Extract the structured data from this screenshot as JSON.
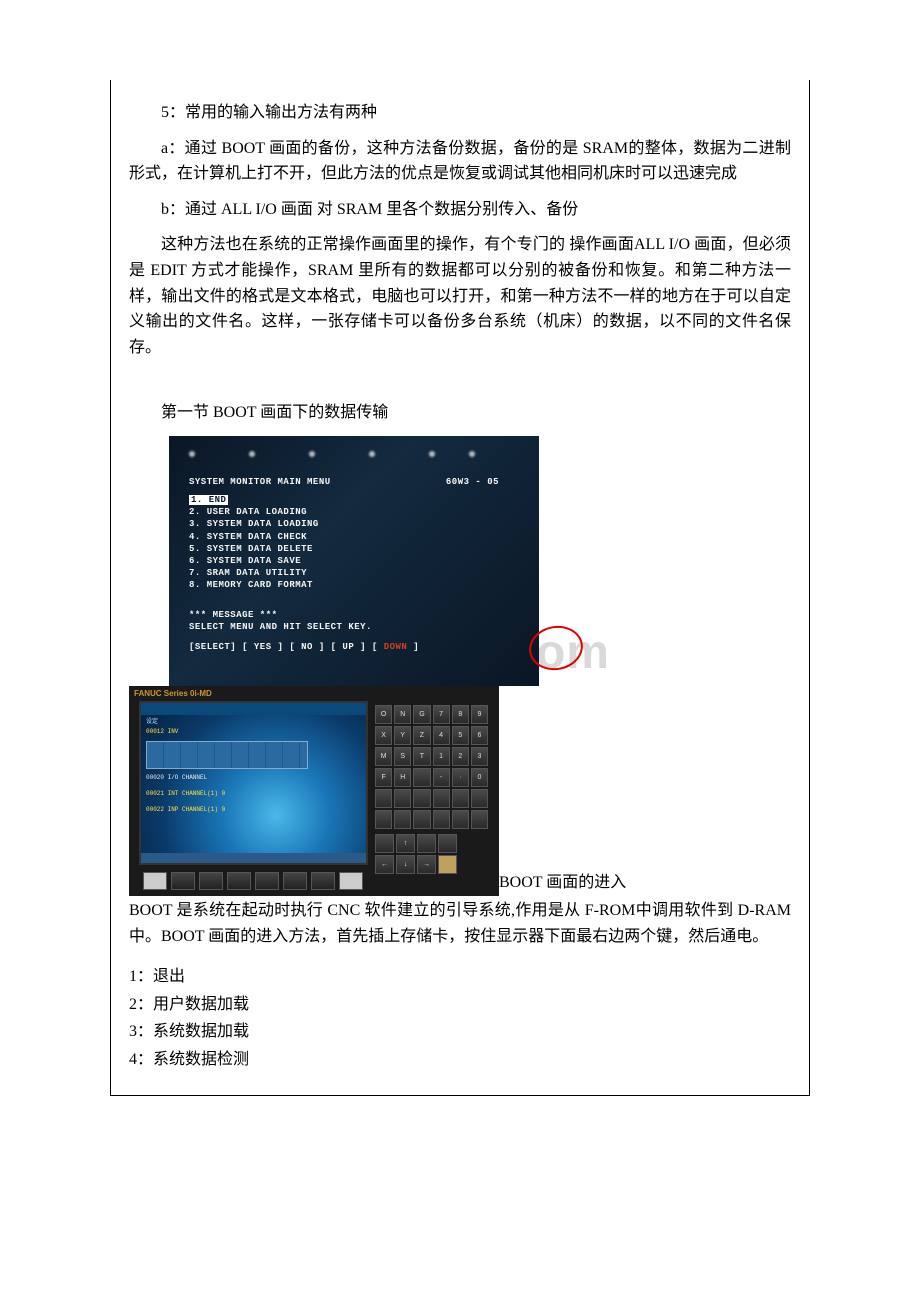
{
  "watermark": "www.bdocx.com",
  "body": {
    "p1": "5：常用的输入输出方法有两种",
    "p2": "a：通过 BOOT 画面的备份，这种方法备份数据，备份的是 SRAM的整体，数据为二进制形式，在计算机上打不开，但此方法的优点是恢复或调试其他相同机床时可以迅速完成",
    "p3": "b：通过 ALL I/O 画面 对 SRAM 里各个数据分别传入、备份",
    "p4": "这种方法也在系统的正常操作画面里的操作，有个专门的 操作画面ALL I/O 画面，但必须是 EDIT 方式才能操作，SRAM 里所有的数据都可以分别的被备份和恢复。和第二种方法一样，输出文件的格式是文本格式，电脑也可以打开，和第一种方法不一样的地方在于可以自定义输出的文件名。这样，一张存储卡可以备份多台系统（机床）的数据，以不同的文件名保存。",
    "section_title": "第一节 BOOT 画面下的数据传输",
    "image_caption": "BOOT 画面的进入",
    "p5": "BOOT 是系统在起动时执行 CNC 软件建立的引导系统,作用是从 F-ROM中调用软件到 D-RAM 中。BOOT 画面的进入方法，首先插上存储卡，按住显示器下面最右边两个键，然后通电。"
  },
  "crt": {
    "title": "SYSTEM MONITOR MAIN MENU",
    "version": "60W3 - 05",
    "menu": {
      "i1": "1. END",
      "i2": "2. USER DATA LOADING",
      "i3": "3. SYSTEM DATA LOADING",
      "i4": "4. SYSTEM DATA CHECK",
      "i5": "5. SYSTEM DATA DELETE",
      "i6": "6. SYSTEM DATA SAVE",
      "i7": "7. SRAM DATA UTILITY",
      "i8": "8. MEMORY CARD FORMAT"
    },
    "msg1": "*** MESSAGE ***",
    "msg2": "SELECT MENU AND HIT SELECT KEY.",
    "buttons": "[SELECT] [ YES  ] [  NO  ] [  UP  ] [ ",
    "buttons_down": "DOWN",
    "buttons_end": " ]"
  },
  "panel": {
    "label": "FANUC Series 0i-MD",
    "sc1": "设定",
    "sc2": "00012 INV",
    "sc3": "00020  I/O CHANNEL",
    "sc4": "00021 INT CHANNEL(1) 0",
    "sc5": "00022 INP CHANNEL(1) 0",
    "keypad": [
      [
        "O",
        "N",
        "G",
        "7",
        "8",
        "9"
      ],
      [
        "X",
        "Y",
        "Z",
        "4",
        "5",
        "6"
      ],
      [
        "M",
        "S",
        "T",
        "1",
        "2",
        "3"
      ],
      [
        "F",
        "H",
        "",
        "-",
        "·",
        "0"
      ],
      [
        "",
        "",
        "",
        "",
        "",
        ""
      ],
      [
        "",
        "",
        "",
        "",
        "",
        ""
      ]
    ]
  },
  "list": {
    "i1": "1：退出",
    "i2": "2：用户数据加载",
    "i3": "3：系统数据加载",
    "i4": "4：系统数据检测"
  }
}
